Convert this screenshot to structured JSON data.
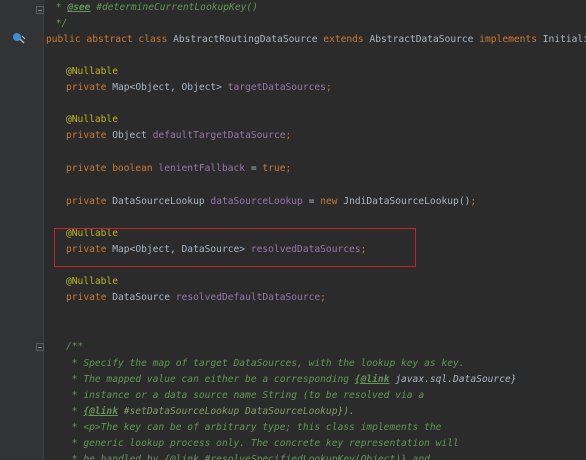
{
  "editor": {
    "lines": [
      {
        "parts": [
          {
            "c": "doc",
            "t": " * "
          },
          {
            "c": "doctag",
            "t": "@see"
          },
          {
            "c": "doc",
            "t": " #determineCurrentLookupKey()"
          }
        ]
      },
      {
        "parts": [
          {
            "c": "doc",
            "t": " */"
          }
        ]
      },
      {
        "parts": [
          {
            "c": "kw",
            "t": "public abstract class "
          },
          {
            "c": "cls",
            "t": "AbstractRoutingDataSource "
          },
          {
            "c": "kw",
            "t": "extends "
          },
          {
            "c": "cls",
            "t": "AbstractDataSource "
          },
          {
            "c": "kw",
            "t": "implements "
          },
          {
            "c": "cls",
            "t": "InitializingBean {"
          }
        ]
      },
      {
        "parts": [
          {
            "c": "ann",
            "t": "@Nullable"
          }
        ]
      },
      {
        "parts": [
          {
            "c": "kw",
            "t": "private "
          },
          {
            "c": "cls",
            "t": "Map<Object, Object> "
          },
          {
            "c": "field",
            "t": "targetDataSources"
          },
          {
            "c": "kw",
            "t": ";"
          }
        ]
      },
      {
        "parts": [
          {
            "c": "ann",
            "t": "@Nullable"
          }
        ]
      },
      {
        "parts": [
          {
            "c": "kw",
            "t": "private "
          },
          {
            "c": "cls",
            "t": "Object "
          },
          {
            "c": "field",
            "t": "defaultTargetDataSource"
          },
          {
            "c": "kw",
            "t": ";"
          }
        ]
      },
      {
        "parts": [
          {
            "c": "kw",
            "t": "private boolean "
          },
          {
            "c": "field",
            "t": "lenientFallback "
          },
          {
            "c": "cls",
            "t": "= "
          },
          {
            "c": "kw",
            "t": "true;"
          }
        ]
      },
      {
        "parts": [
          {
            "c": "kw",
            "t": "private "
          },
          {
            "c": "cls",
            "t": "DataSourceLookup "
          },
          {
            "c": "field",
            "t": "dataSourceLookup "
          },
          {
            "c": "cls",
            "t": "= "
          },
          {
            "c": "kw",
            "t": "new "
          },
          {
            "c": "cls",
            "t": "JndiDataSourceLookup()"
          },
          {
            "c": "kw",
            "t": ";"
          }
        ]
      },
      {
        "parts": [
          {
            "c": "ann",
            "t": "@Nullable"
          }
        ]
      },
      {
        "parts": [
          {
            "c": "kw",
            "t": "private "
          },
          {
            "c": "cls",
            "t": "Map<Object, DataSource> "
          },
          {
            "c": "field",
            "t": "resolvedDataSources"
          },
          {
            "c": "kw",
            "t": ";"
          }
        ]
      },
      {
        "parts": [
          {
            "c": "ann",
            "t": "@Nullable"
          }
        ]
      },
      {
        "parts": [
          {
            "c": "kw",
            "t": "private "
          },
          {
            "c": "cls",
            "t": "DataSource "
          },
          {
            "c": "field",
            "t": "resolvedDefaultDataSource"
          },
          {
            "c": "kw",
            "t": ";"
          }
        ]
      },
      {
        "parts": [
          {
            "c": "doc",
            "t": "/**"
          }
        ]
      },
      {
        "parts": [
          {
            "c": "doc",
            "t": " * Specify the map of target DataSources, with the lookup key as key."
          }
        ]
      },
      {
        "parts": [
          {
            "c": "doc",
            "t": " * The mapped value can either be a corresponding "
          },
          {
            "c": "doctag",
            "t": "{@link"
          },
          {
            "c": "doclink",
            "t": " javax.sql.DataSource}"
          }
        ]
      },
      {
        "parts": [
          {
            "c": "doc",
            "t": " * instance or a data source name String (to be resolved via a"
          }
        ]
      },
      {
        "parts": [
          {
            "c": "doc",
            "t": " * "
          },
          {
            "c": "doctag",
            "t": "{@link"
          },
          {
            "c": "docref",
            "t": " #setDataSourceLookup DataSourceLookup})."
          }
        ]
      },
      {
        "parts": [
          {
            "c": "doc",
            "t": " * <p>The key can be of arbitrary type; this class implements the"
          }
        ]
      },
      {
        "parts": [
          {
            "c": "doc",
            "t": " * generic lookup process only. The concrete key representation will"
          }
        ]
      },
      {
        "parts": [
          {
            "c": "doc",
            "t": " * be handled by {@link #resolveSpecifiedLookupKey(Object)} and"
          }
        ]
      }
    ]
  }
}
